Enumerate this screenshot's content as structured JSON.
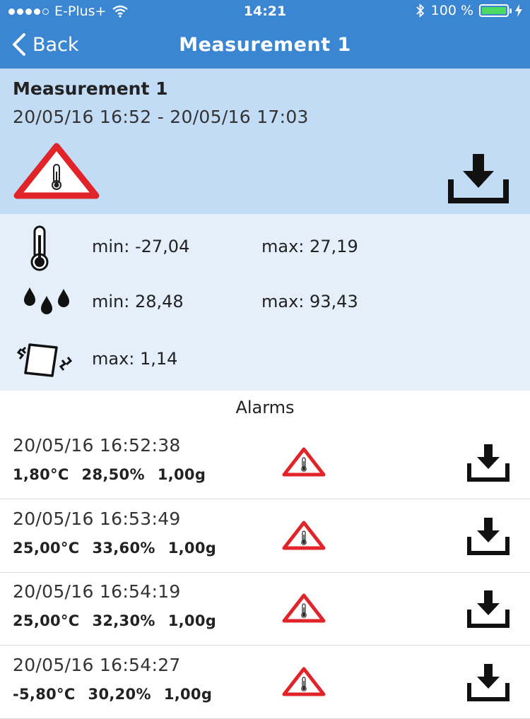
{
  "status_bar": {
    "carrier": "E-Plus+",
    "time": "14:21",
    "battery": "100 %",
    "signal_bars": 4,
    "battery_color": "#4cd964"
  },
  "nav": {
    "back_label": "Back",
    "title": "Measurement 1",
    "bar_color": "#3b86d2"
  },
  "measurement": {
    "title": "Measurement 1",
    "range": "20/05/16 16:52 - 20/05/16 17:03",
    "header_color": "#c2dcf6",
    "stats_color": "#e5effa"
  },
  "stats": {
    "temperature": {
      "min": "min: -27,04",
      "max": "max: 27,19"
    },
    "humidity": {
      "min": "min: 28,48",
      "max": "max: 93,43"
    },
    "shock": {
      "max": "max: 1,14"
    }
  },
  "alarms": {
    "title": "Alarms",
    "items": [
      {
        "time": "20/05/16 16:52:38",
        "temp": "1,80°C",
        "humidity": "28,50%",
        "shock": "1,00g"
      },
      {
        "time": "20/05/16 16:53:49",
        "temp": "25,00°C",
        "humidity": "33,60%",
        "shock": "1,00g"
      },
      {
        "time": "20/05/16 16:54:19",
        "temp": "25,00°C",
        "humidity": "32,30%",
        "shock": "1,00g"
      },
      {
        "time": "20/05/16 16:54:27",
        "temp": "-5,80°C",
        "humidity": "30,20%",
        "shock": "1,00g"
      }
    ]
  }
}
